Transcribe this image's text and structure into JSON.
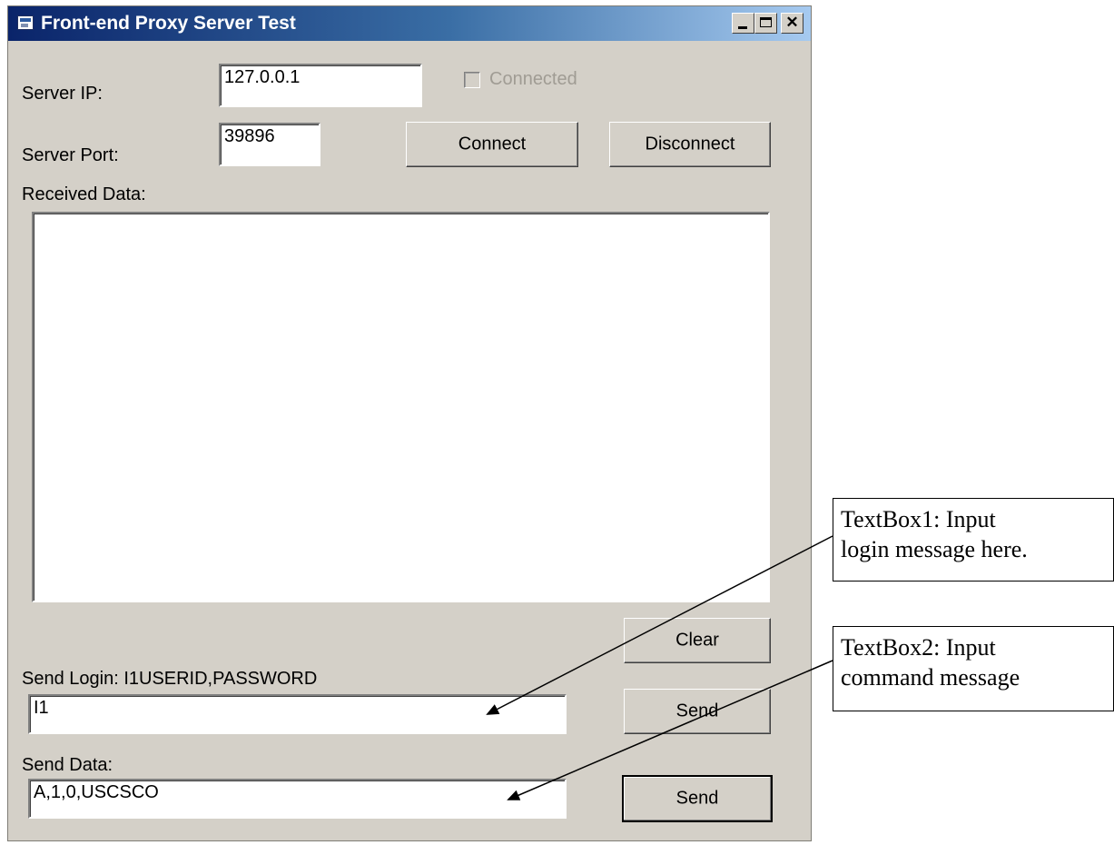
{
  "window": {
    "title": "Front-end Proxy Server Test",
    "title_icon": "app-icon",
    "buttons": [
      "minimize",
      "maximize",
      "close"
    ]
  },
  "server_ip": {
    "label": "Server IP:",
    "value": "127.0.0.1"
  },
  "connected": {
    "label": "Connected",
    "checked": false,
    "enabled": false
  },
  "server_port": {
    "label": "Server Port:",
    "value": "39896"
  },
  "connect_label": "Connect",
  "disconnect_label": "Disconnect",
  "received": {
    "label": "Received Data:",
    "value": ""
  },
  "clear_label": "Clear",
  "login": {
    "label": "Send Login:  I1USERID,PASSWORD",
    "value": "I1",
    "send_label": "Send"
  },
  "data": {
    "label": "Send Data:",
    "value": "A,1,0,USCSCO",
    "send_label": "Send"
  },
  "annotations": [
    {
      "text_line1": "TextBox1: Input",
      "text_line2": "login message here."
    },
    {
      "text_line1": "TextBox2: Input",
      "text_line2": "command message"
    }
  ],
  "colors": {
    "face": "#d4d0c8",
    "title_start": "#0a246a",
    "title_end": "#a6caf0"
  }
}
